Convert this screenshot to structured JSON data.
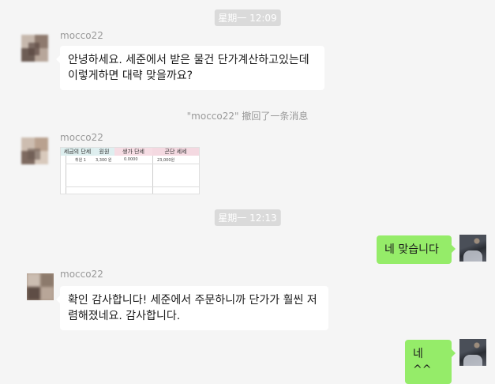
{
  "timestamps": [
    "星期一 12:09",
    "星期一 12:13"
  ],
  "notice": "\"mocco22\" 撤回了一条消息",
  "contact": {
    "name": "mocco22"
  },
  "messages": {
    "m1": "안녕하세요. 세준에서 받은 물건 단가계산하고있는데 이렇게하면 대략 맞을까요?",
    "m2": "네 맞습니다",
    "m3": "확인 감사합니다! 세준에서 주문하니까 단가가 훨씬 저렴해졌네요. 감사합니다.",
    "m4": "네 ^^"
  },
  "sheet": {
    "headers": [
      "세금의 단세",
      "원원",
      "생가 단세",
      "곤단 세세"
    ],
    "row": [
      "취원 1",
      "3,300 원",
      "0.0000",
      "23,000원"
    ]
  },
  "colors": {
    "background": "#f5f5f5",
    "incoming_bubble": "#ffffff",
    "outgoing_bubble": "#95ec69",
    "timestamp_bg": "#dadada",
    "meta_text": "#999999"
  }
}
